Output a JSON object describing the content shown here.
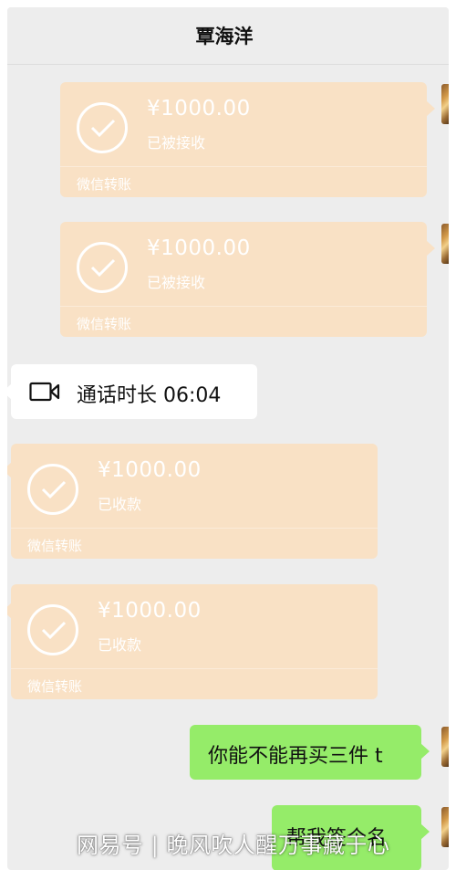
{
  "header": {
    "title": "覃海洋"
  },
  "messages": {
    "transfer_1": {
      "amount": "¥1000.00",
      "status": "已被接收",
      "label": "微信转账"
    },
    "transfer_2": {
      "amount": "¥1000.00",
      "status": "已被接收",
      "label": "微信转账"
    },
    "call": {
      "text": "通话时长 06:04"
    },
    "transfer_3": {
      "amount": "¥1000.00",
      "status": "已收款",
      "label": "微信转账"
    },
    "transfer_4": {
      "amount": "¥1000.00",
      "status": "已收款",
      "label": "微信转账"
    },
    "text_1": {
      "text": "你能不能再买三件 t"
    },
    "text_2": {
      "text": "帮我签个名"
    }
  },
  "watermark": {
    "text": "网易号 | 晚风吹人醒万事藏于心"
  },
  "colors": {
    "background": "#ededed",
    "transfer_bubble": "#f9e1c5",
    "sent_bubble": "#95ec69",
    "received_bubble": "#ffffff"
  },
  "icons": {
    "check": "check-circle-icon",
    "video_call": "video-camera-icon"
  }
}
